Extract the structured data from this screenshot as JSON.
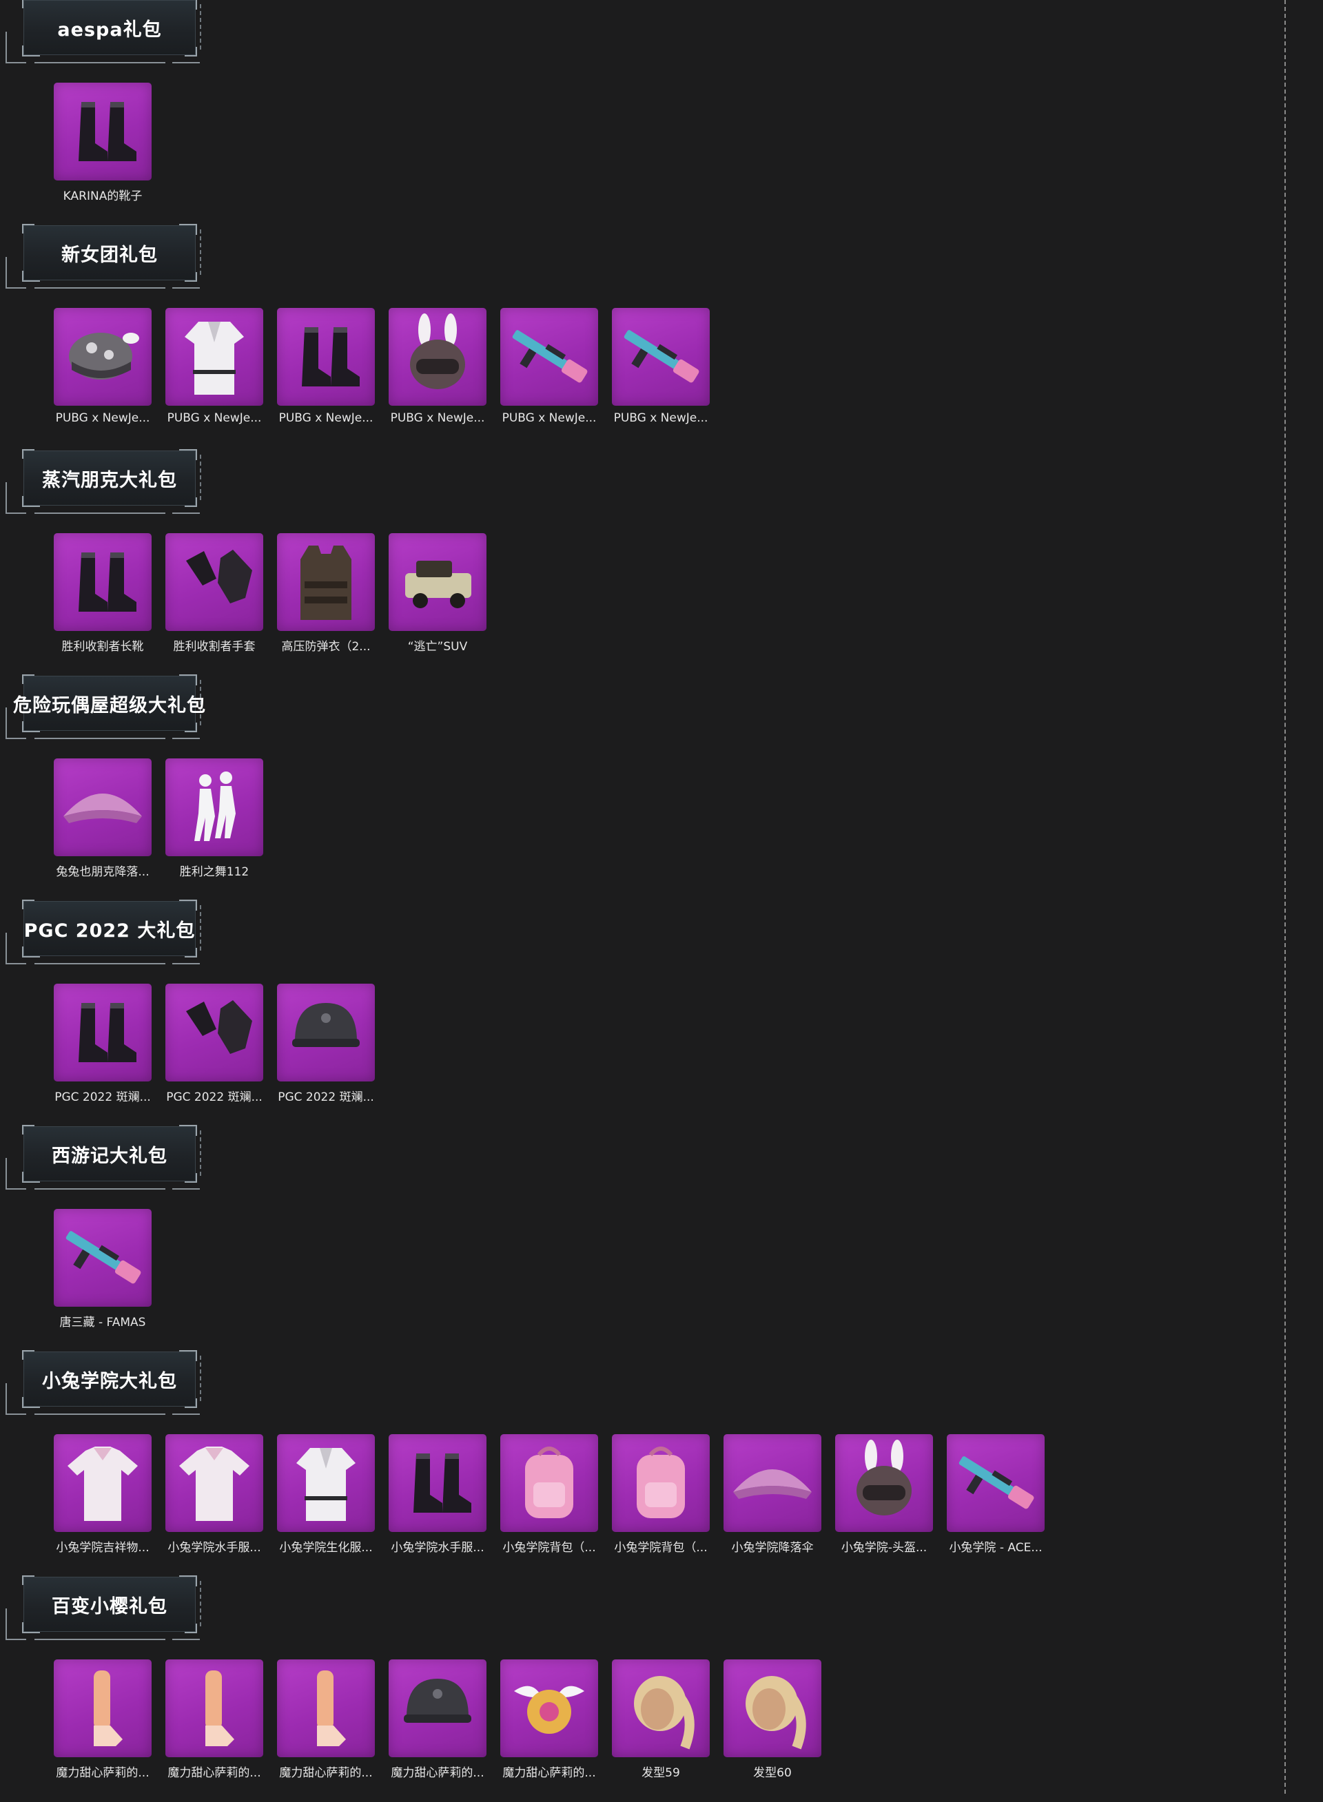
{
  "sections": [
    {
      "title": "aespa礼包",
      "items": [
        {
          "label": "KARINA的靴子",
          "icon": "boots-icon"
        }
      ]
    },
    {
      "title": "新女团礼包",
      "items": [
        {
          "label": "PUBG x NewJe...",
          "icon": "hat-icon"
        },
        {
          "label": "PUBG x NewJe...",
          "icon": "outfit-icon"
        },
        {
          "label": "PUBG x NewJe...",
          "icon": "boots-icon"
        },
        {
          "label": "PUBG x NewJe...",
          "icon": "bunny-helmet-icon"
        },
        {
          "label": "PUBG x NewJe...",
          "icon": "rifle-icon"
        },
        {
          "label": "PUBG x NewJe...",
          "icon": "rifle-icon"
        }
      ]
    },
    {
      "title": "蒸汽朋克大礼包",
      "items": [
        {
          "label": "胜利收割者长靴",
          "icon": "boots-icon"
        },
        {
          "label": "胜利收割者手套",
          "icon": "gloves-icon"
        },
        {
          "label": "高压防弹衣（2...",
          "icon": "vest-icon"
        },
        {
          "label": "“逃亡”SUV",
          "icon": "car-icon"
        }
      ]
    },
    {
      "title": "危险玩偶屋超级大礼包",
      "items": [
        {
          "label": "兔兔也朋克降落...",
          "icon": "parachute-icon"
        },
        {
          "label": "胜利之舞112",
          "icon": "dance-emote-icon"
        }
      ]
    },
    {
      "title": "PGC 2022 大礼包",
      "items": [
        {
          "label": "PGC 2022 斑斓...",
          "icon": "boots-icon"
        },
        {
          "label": "PGC 2022 斑斓...",
          "icon": "gloves-icon"
        },
        {
          "label": "PGC 2022 斑斓...",
          "icon": "helmet-icon"
        }
      ]
    },
    {
      "title": "西游记大礼包",
      "items": [
        {
          "label": "唐三藏 - FAMAS",
          "icon": "rifle-icon"
        }
      ]
    },
    {
      "title": "小兔学院大礼包",
      "items": [
        {
          "label": "小兔学院吉祥物...",
          "icon": "shirt-icon"
        },
        {
          "label": "小兔学院水手服...",
          "icon": "shirt-icon"
        },
        {
          "label": "小兔学院生化服...",
          "icon": "outfit-icon"
        },
        {
          "label": "小兔学院水手服...",
          "icon": "boots-icon"
        },
        {
          "label": "小兔学院背包（...",
          "icon": "backpack-icon"
        },
        {
          "label": "小兔学院背包（...",
          "icon": "backpack-icon"
        },
        {
          "label": "小兔学院降落伞",
          "icon": "parachute-icon"
        },
        {
          "label": "小兔学院-头盔...",
          "icon": "bunny-helmet-icon"
        },
        {
          "label": "小兔学院 - ACE...",
          "icon": "rifle-icon"
        }
      ]
    },
    {
      "title": "百变小樱礼包",
      "items": [
        {
          "label": "魔力甜心萨莉的...",
          "icon": "stockings-icon"
        },
        {
          "label": "魔力甜心萨莉的...",
          "icon": "stockings-icon"
        },
        {
          "label": "魔力甜心萨莉的...",
          "icon": "stockings-icon"
        },
        {
          "label": "魔力甜心萨莉的...",
          "icon": "helmet-icon"
        },
        {
          "label": "魔力甜心萨莉的...",
          "icon": "winged-backpack-icon"
        },
        {
          "label": "发型59",
          "icon": "hairstyle-icon"
        },
        {
          "label": "发型60",
          "icon": "hairstyle-icon"
        }
      ]
    }
  ]
}
